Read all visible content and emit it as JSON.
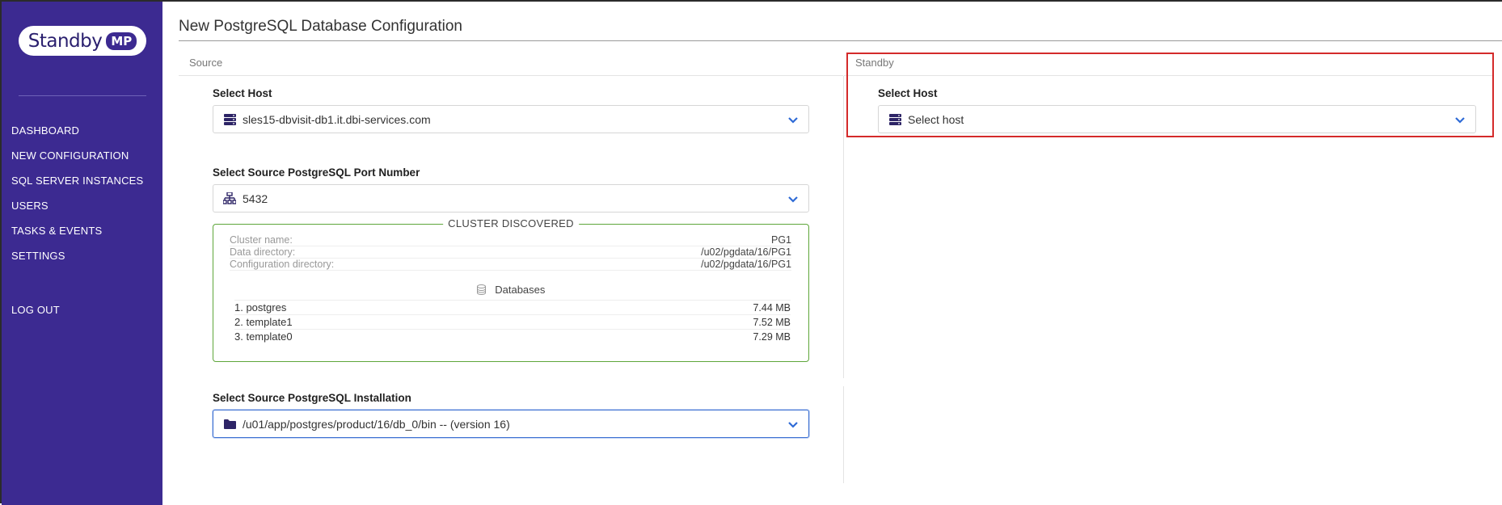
{
  "app": {
    "logo_text": "Standby",
    "logo_badge": "MP"
  },
  "sidebar": {
    "items": [
      {
        "label": "DASHBOARD"
      },
      {
        "label": "NEW CONFIGURATION"
      },
      {
        "label": "SQL SERVER INSTANCES"
      },
      {
        "label": "USERS"
      },
      {
        "label": "TASKS & EVENTS"
      },
      {
        "label": "SETTINGS"
      }
    ],
    "logout_label": "LOG OUT"
  },
  "page": {
    "title": "New PostgreSQL Database Configuration"
  },
  "source": {
    "heading": "Source",
    "host_label": "Select Host",
    "host_value": "sles15-dbvisit-db1.it.dbi-services.com",
    "port_label": "Select Source PostgreSQL Port Number",
    "port_value": "5432",
    "cluster": {
      "legend": "CLUSTER DISCOVERED",
      "cluster_name_label": "Cluster name:",
      "cluster_name_value": "PG1",
      "data_dir_label": "Data directory:",
      "data_dir_value": "/u02/pgdata/16/PG1",
      "config_dir_label": "Configuration directory:",
      "config_dir_value": "/u02/pgdata/16/PG1",
      "databases_heading": "Databases",
      "databases": [
        {
          "name": "1. postgres",
          "size": "7.44 MB"
        },
        {
          "name": "2. template1",
          "size": "7.52 MB"
        },
        {
          "name": "3. template0",
          "size": "7.29 MB"
        }
      ]
    },
    "install_label": "Select Source PostgreSQL Installation",
    "install_value": "/u01/app/postgres/product/16/db_0/bin -- (version 16)"
  },
  "standby": {
    "heading": "Standby",
    "host_label": "Select Host",
    "host_placeholder": "Select host"
  },
  "colors": {
    "sidebar_bg": "#3c2a91",
    "accent_blue": "#3b6fd1",
    "cluster_border": "#5ea63a",
    "highlight_red": "#d42a2a"
  }
}
